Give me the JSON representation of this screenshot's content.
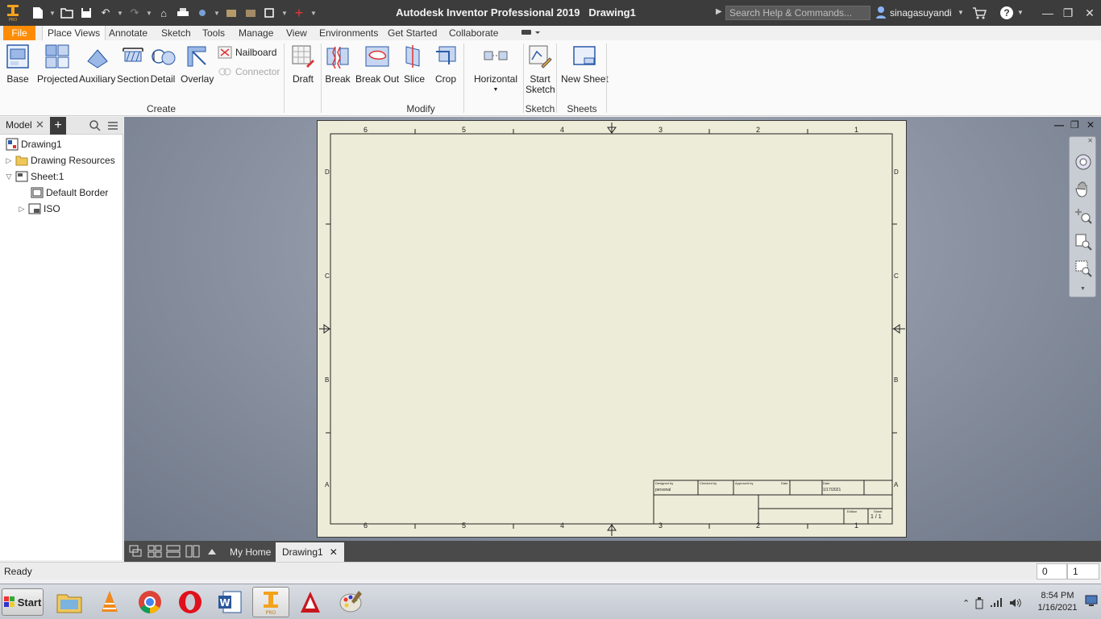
{
  "titlebar": {
    "app_logo": "inventor-pro-logo",
    "app_name": "Autodesk Inventor Professional 2019",
    "document": "Drawing1",
    "search_placeholder": "Search Help & Commands...",
    "user": "sinagasuyandi"
  },
  "ribbon_tabs": [
    "File",
    "Place Views",
    "Annotate",
    "Sketch",
    "Tools",
    "Manage",
    "View",
    "Environments",
    "Get Started",
    "Collaborate"
  ],
  "active_tab": "Place Views",
  "ribbon": {
    "create": {
      "label": "Create",
      "buttons": [
        "Base",
        "Projected",
        "Auxiliary",
        "Section",
        "Detail",
        "Overlay"
      ],
      "nailboard": "Nailboard",
      "connector": "Connector"
    },
    "modify": {
      "label": "Modify",
      "buttons": [
        "Draft",
        "Break",
        "Break Out",
        "Slice",
        "Crop"
      ],
      "horizontal": "Horizontal"
    },
    "sketch": {
      "label": "Sketch",
      "start_sketch": "Start Sketch"
    },
    "sheets": {
      "label": "Sheets",
      "new_sheet": "New Sheet"
    }
  },
  "browser": {
    "title": "Model",
    "tree": [
      "Drawing1",
      "Drawing Resources",
      "Sheet:1",
      "Default Border",
      "ISO"
    ]
  },
  "sheet": {
    "zone_columns": [
      "6",
      "5",
      "4",
      "3",
      "2",
      "1"
    ],
    "zone_rows": [
      "D",
      "C",
      "B",
      "A"
    ],
    "title_block": {
      "designed_by": "Designed by",
      "designer": "personal",
      "checked_by": "Checked by",
      "approved_by": "Approved by",
      "date_label": "Date",
      "date_label2": "Date",
      "date_value": "1/17/2021",
      "edition": "Edition",
      "sheet_label": "Sheet",
      "sheet_value": "1 / 1"
    }
  },
  "doc_tabs": [
    "My Home",
    "Drawing1"
  ],
  "status": {
    "text": "Ready",
    "val1": "0",
    "val2": "1"
  },
  "taskbar": {
    "start": "Start",
    "apps": [
      "file-explorer",
      "vlc",
      "chrome",
      "opera",
      "word",
      "inventor",
      "autocad",
      "paint"
    ],
    "time": "8:54 PM",
    "date": "1/16/2021"
  },
  "colors": {
    "file_tab": "#ff8c00",
    "titlebar": "#3c3c3c",
    "sheet": "#ececd8"
  }
}
